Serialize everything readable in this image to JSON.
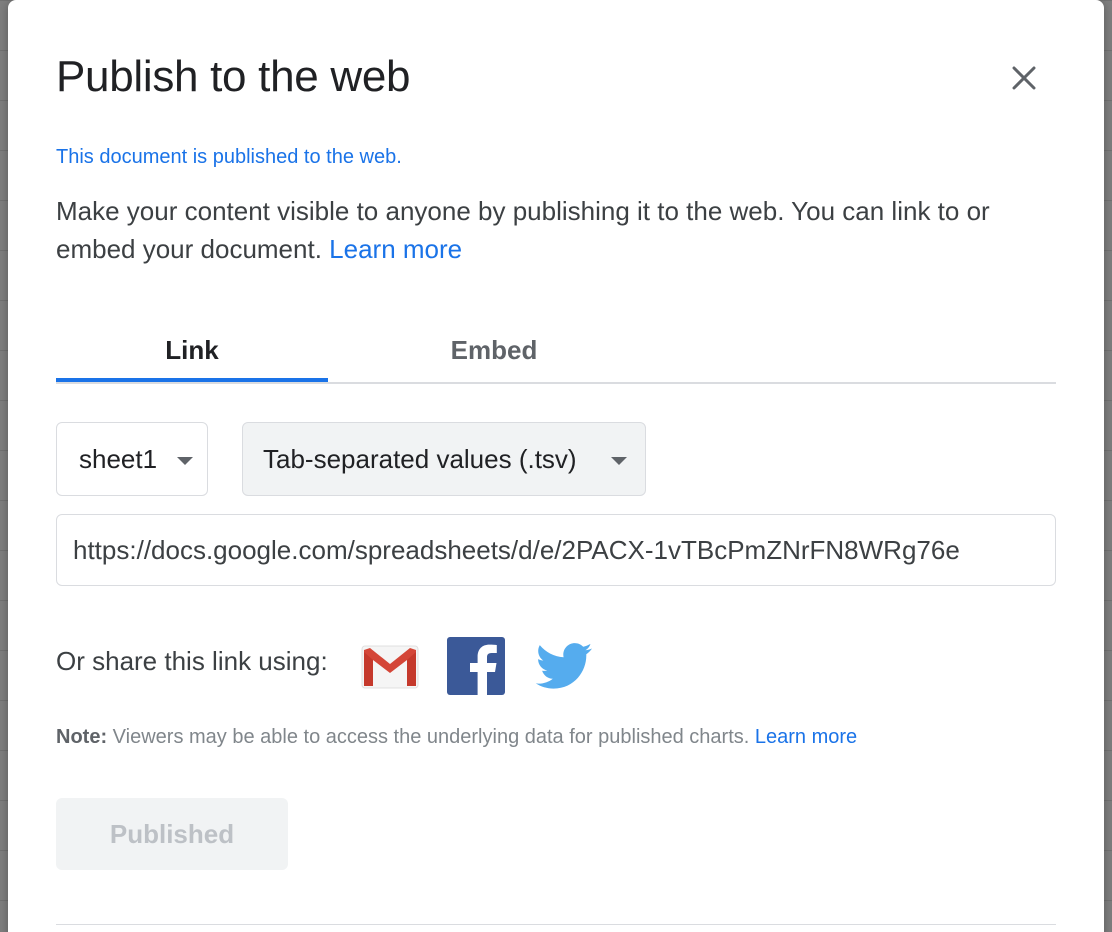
{
  "dialog": {
    "title": "Publish to the web",
    "close_icon": "close-icon",
    "status": "This document is published to the web.",
    "description": "Make your content visible to anyone by publishing it to the web. You can link to or embed your document.",
    "learn_more": "Learn more"
  },
  "tabs": [
    {
      "label": "Link",
      "active": true
    },
    {
      "label": "Embed",
      "active": false
    }
  ],
  "sheet_select": {
    "value": "sheet1"
  },
  "format_select": {
    "value": "Tab-separated values (.tsv)"
  },
  "url_field": {
    "value": "https://docs.google.com/spreadsheets/d/e/2PACX-1vTBcPmZNrFN8WRg76e"
  },
  "share": {
    "label": "Or share this link using:",
    "icons": [
      "gmail-icon",
      "facebook-icon",
      "twitter-icon"
    ]
  },
  "note": {
    "bold": "Note:",
    "text": " Viewers may be able to access the underlying data for published charts. ",
    "learn_more": "Learn more"
  },
  "publish_button": {
    "label": "Published",
    "disabled": true
  },
  "colors": {
    "accent": "#1a73e8",
    "facebook": "#3b5998",
    "twitter": "#55acee",
    "gmail_red": "#d44638"
  }
}
